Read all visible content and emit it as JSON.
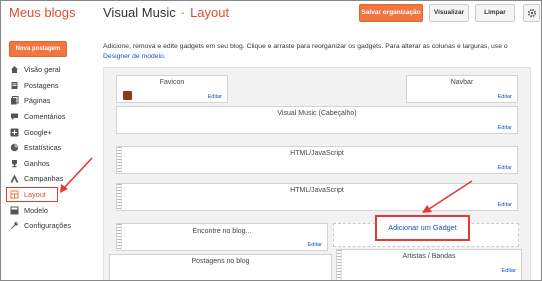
{
  "header": {
    "brand": "Meus blogs",
    "blog_title": "Visual Music",
    "separator": "·",
    "section": "Layout",
    "buttons": {
      "save": "Salvar organização",
      "view": "Visualizar",
      "clear": "Limpar"
    }
  },
  "sidebar": {
    "new_post": "Nova postagem",
    "items": [
      {
        "label": "Visão geral",
        "icon": "house-icon"
      },
      {
        "label": "Postagens",
        "icon": "document-icon"
      },
      {
        "label": "Páginas",
        "icon": "pages-icon"
      },
      {
        "label": "Comentários",
        "icon": "comment-icon"
      },
      {
        "label": "Google+",
        "icon": "google-plus-icon"
      },
      {
        "label": "Estatísticas",
        "icon": "pie-chart-icon"
      },
      {
        "label": "Ganhos",
        "icon": "trophy-icon"
      },
      {
        "label": "Campanhas",
        "icon": "campaign-icon"
      },
      {
        "label": "Layout",
        "icon": "layout-icon",
        "active": true
      },
      {
        "label": "Modelo",
        "icon": "template-icon"
      },
      {
        "label": "Configurações",
        "icon": "wrench-icon"
      }
    ]
  },
  "main": {
    "intro_text": "Adicione, remova e edite gadgets em seu blog. Clique e arraste para reorganizar os gadgets. Para alterar as colunas e larguras, use o ",
    "intro_link": "Designer de modelo",
    "intro_end": ".",
    "edit_label": "Editar",
    "add_gadget": "Adicionar um Gadget",
    "gadgets": {
      "favicon": "Favicon",
      "navbar": "Navbar",
      "header": "Visual Music (Cabeçalho)",
      "html1": "HTML/JavaScript",
      "html2": "HTML/JavaScript",
      "search": "Encontre no blog...",
      "posts": "Postagens no blog",
      "artists": "Artistas / Bandas"
    }
  },
  "colors": {
    "accent": "#dd4b39",
    "orange_button": "#f1753f",
    "link": "#1155cc",
    "annotation": "#e53935"
  }
}
